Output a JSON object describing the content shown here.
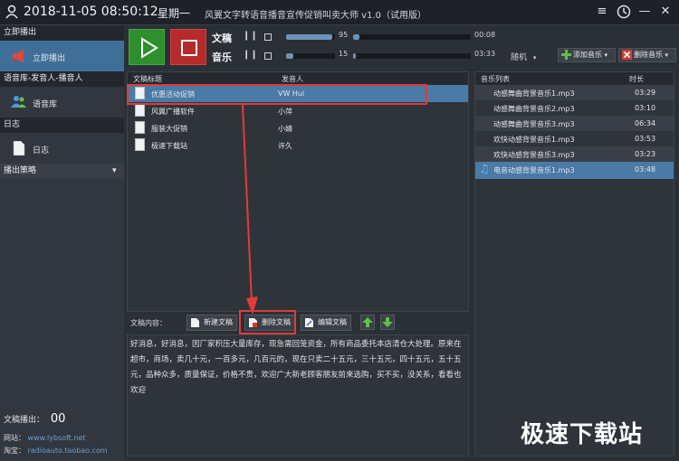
{
  "titlebar": {
    "datetime": "2018-11-05 08:50:12",
    "weekday": "星期一",
    "app_title": "风翼文字转语音播音宣传促销叫卖大师 v1.0（试用版）"
  },
  "sidebar": {
    "sections": [
      {
        "header": "立即播出",
        "item": "立即播出"
      },
      {
        "header": "语音库-发音人-播音人",
        "item": "语音库"
      },
      {
        "header": "日志",
        "item": "日志"
      }
    ],
    "strategy": "播出策略",
    "broadcast_label": "文稿播出：",
    "broadcast_count": "00",
    "website_label": "网站：",
    "website": "www.lybsoft.net",
    "taobao_label": "淘宝：",
    "taobao": "radioauto.taobao.com"
  },
  "controls": {
    "doc_label": "文稿",
    "music_label": "音乐",
    "doc_volume": "95",
    "doc_volume_level": 0.95,
    "doc_time": "00:08",
    "doc_progress": 0.05,
    "music_volume": "15",
    "music_volume_level": 0.15,
    "music_time": "03:33",
    "music_progress": 0.02,
    "mode": "随机",
    "add_music": "添加音乐",
    "delete_music": "删除音乐"
  },
  "docs": {
    "col_title": "文稿标题",
    "col_speaker": "发音人",
    "rows": [
      {
        "title": "优惠活动促销",
        "speaker": "VW Hui"
      },
      {
        "title": "风翼广播软件",
        "speaker": "小萍"
      },
      {
        "title": "服装大促销",
        "speaker": "小婧"
      },
      {
        "title": "极速下载站",
        "speaker": "许久"
      }
    ]
  },
  "music": {
    "col_list": "音乐列表",
    "col_duration": "时长",
    "rows": [
      {
        "name": "动感舞曲背景音乐1.mp3",
        "duration": "03:29"
      },
      {
        "name": "动感舞曲背景音乐2.mp3",
        "duration": "03:10"
      },
      {
        "name": "动感舞曲背景音乐3.mp3",
        "duration": "06:34"
      },
      {
        "name": "欢快动感背景音乐1.mp3",
        "duration": "03:53"
      },
      {
        "name": "欢快动感背景音乐3.mp3",
        "duration": "03:23"
      },
      {
        "name": "电音动感背景音乐1.mp3",
        "duration": "03:48"
      }
    ]
  },
  "content": {
    "label": "文稿内容：",
    "new_doc": "新建文稿",
    "delete_doc": "删除文稿",
    "edit_doc": "编辑文稿",
    "text": "好消息，好消息，因厂家积压大量库存，现急需回笼资金，所有商品委托本店清仓大处理。原来在超市，商场，卖几十元，一百多元，几百元的，现在只卖二十五元，三十五元，四十五元，五十五元，品种众多，质量保证，价格不贵，欢迎广大新老顾客朋友前来选购，买不买，没关系，看看也欢迎"
  },
  "watermark": "极速下载站",
  "colors": {
    "accent": "#4a7aa6",
    "highlight": "#e23b3b",
    "play": "#2f8f2f",
    "stop": "#b52a2a"
  }
}
